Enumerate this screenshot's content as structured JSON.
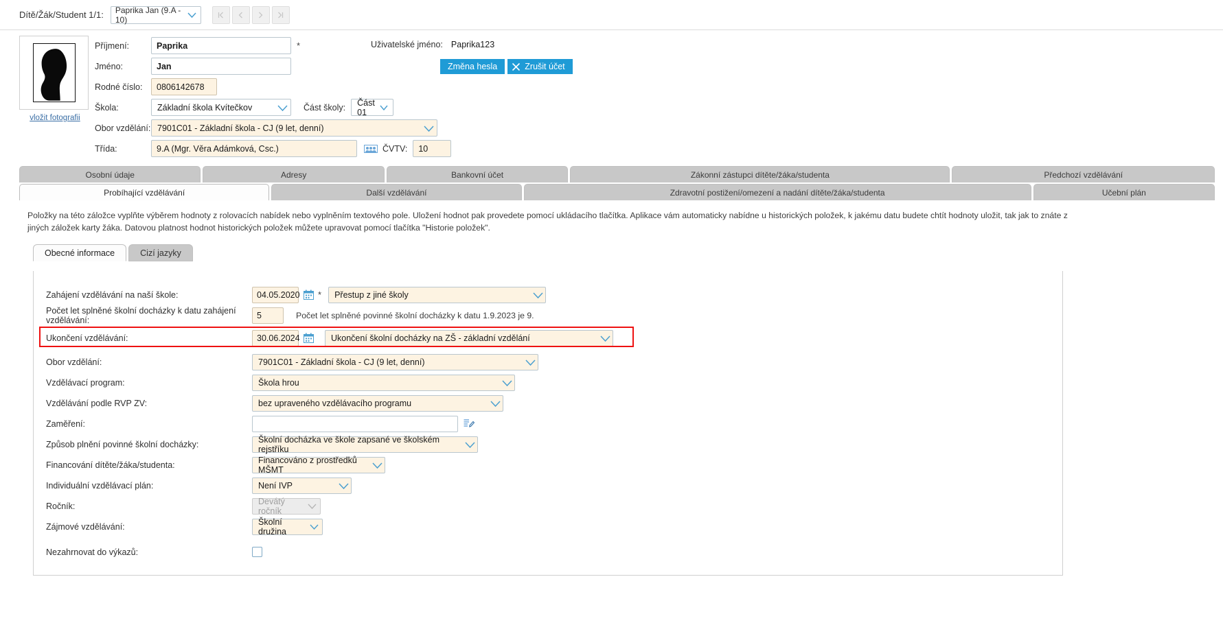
{
  "topbar": {
    "label": "Dítě/Žák/Student 1/1:",
    "student_value": "Paprika Jan (9.A - 10)",
    "nav": [
      "first",
      "prev",
      "next",
      "last"
    ]
  },
  "identity": {
    "photo_link": "vložit fotografii",
    "fields": {
      "surname_label": "Příjmení:",
      "surname_value": "Paprika",
      "required_mark": "*",
      "firstname_label": "Jméno:",
      "firstname_value": "Jan",
      "birthnumber_label": "Rodné číslo:",
      "birthnumber_value": "0806142678",
      "school_label": "Škola:",
      "school_value": "Základní škola Kvítečkov",
      "schoolpart_label": "Část školy:",
      "schoolpart_value": "Část 01",
      "field_label": "Obor vzdělání:",
      "field_value": "7901C01 - Základní škola - CJ (9 let, denní)",
      "class_label": "Třída:",
      "class_value": "9.A (Mgr. Věra Adámková, Csc.)",
      "cvtv_label": "ČVTV:",
      "cvtv_value": "10"
    },
    "account": {
      "username_label": "Uživatelské jméno:",
      "username_value": "Paprika123",
      "change_password_label": "Změna hesla",
      "cancel_account_label": "Zrušit účet"
    }
  },
  "tabs_row1": [
    {
      "label": "Osobní údaje",
      "active": false
    },
    {
      "label": "Adresy",
      "active": false
    },
    {
      "label": "Bankovní účet",
      "active": false
    },
    {
      "label": "Zákonní zástupci dítěte/žáka/studenta",
      "active": false
    },
    {
      "label": "Předchozí vzdělávání",
      "active": false
    }
  ],
  "tabs_row2": [
    {
      "label": "Probíhající vzdělávání",
      "active": true
    },
    {
      "label": "Další vzdělávání",
      "active": false
    },
    {
      "label": "Zdravotní postižení/omezení a nadání dítěte/žáka/studenta",
      "active": false
    },
    {
      "label": "Učební plán",
      "active": false
    }
  ],
  "intro_text": "Položky na této záložce vyplňte výběrem hodnoty z rolovacích nabídek nebo vyplněním textového pole. Uložení hodnot pak provedete pomocí ukládacího tlačítka. Aplikace vám automaticky nabídne u historických položek, k jakému datu budete chtít hodnoty uložit, tak jak to znáte z jiných záložek karty žáka. Datovou platnost hodnot historických položek můžete upravovat pomocí tlačítka \"Historie položek\".",
  "subtabs": [
    {
      "label": "Obecné informace",
      "active": true
    },
    {
      "label": "Cizí jazyky",
      "active": false
    }
  ],
  "form": {
    "start_label": "Zahájení vzdělávání na naší škole:",
    "start_date": "04.05.2020",
    "start_required": "*",
    "start_reason": "Přestup z jiné školy",
    "years_label": "Počet let splněné školní docházky k datu zahájení vzdělávání:",
    "years_value": "5",
    "years_hint": "Počet let splněné povinné školní docházky k datu 1.9.2023 je 9.",
    "end_label": "Ukončení vzdělávání:",
    "end_date": "30.06.2024",
    "end_reason": "Ukončení školní docházky na ZŠ - základní vzdělání",
    "field_label": "Obor vzdělání:",
    "field_value": "7901C01 - Základní škola - CJ (9 let, denní)",
    "program_label": "Vzdělávací program:",
    "program_value": "Škola hrou",
    "rvp_label": "Vzdělávání podle RVP ZV:",
    "rvp_value": "bez upraveného vzdělávacího programu",
    "focus_label": "Zaměření:",
    "focus_value": "",
    "attendance_label": "Způsob plnění povinné školní docházky:",
    "attendance_value": "Školní docházka ve škole zapsané ve školském rejstříku",
    "financing_label": "Financování dítěte/žáka/studenta:",
    "financing_value": "Financováno z prostředků MŠMT",
    "ivp_label": "Individuální vzdělávací plán:",
    "ivp_value": "Není IVP",
    "grade_label": "Ročník:",
    "grade_value": "Devátý ročník",
    "interest_label": "Zájmové vzdělávání:",
    "interest_value": "Školní družina",
    "exclude_label": "Nezahrnovat do výkazů:"
  },
  "colors": {
    "accent_blue": "#1f9bd6",
    "highlight_red": "#ee1111",
    "field_tan": "#fdf3e2",
    "tab_grey": "#c8c8c8"
  }
}
